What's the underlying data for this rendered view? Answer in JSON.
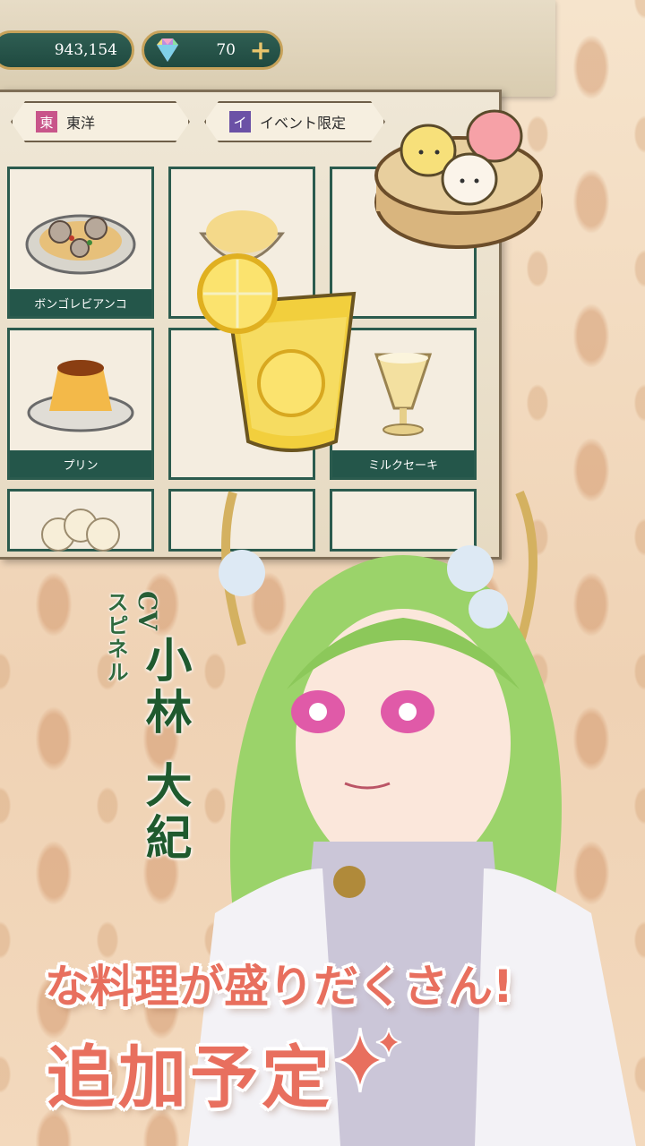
{
  "currency": {
    "gold": "943,154",
    "gems": "70"
  },
  "tabs": [
    {
      "badge": "東",
      "label": "東洋"
    },
    {
      "badge": "イ",
      "label": "イベント限定"
    }
  ],
  "menu_items": [
    {
      "label": "ボンゴレビアンコ"
    },
    {
      "label": ""
    },
    {
      "label": ""
    },
    {
      "label": "プリン"
    },
    {
      "label": ""
    },
    {
      "label": "ミルクセーキ"
    }
  ],
  "voice_credit": {
    "character": "スピネル",
    "cv": "CV",
    "actor": "小林 大紀"
  },
  "banner": {
    "line1": "な料理が盛りだくさん!",
    "line2": "追加予定"
  },
  "colors": {
    "accent_green": "#24564a",
    "banner_pink": "#e86f5e",
    "frame_gold": "#c7a25a"
  }
}
